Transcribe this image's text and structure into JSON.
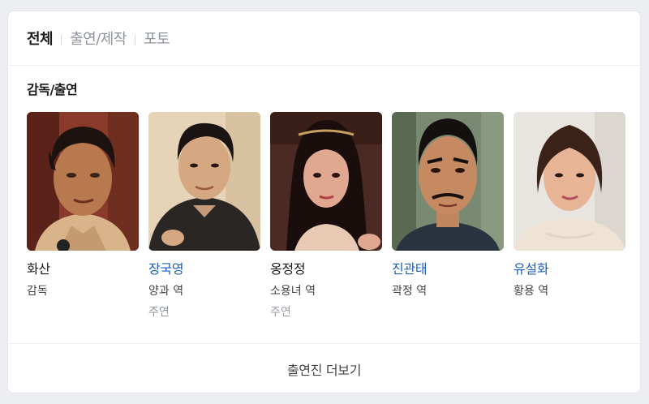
{
  "tabs": [
    {
      "label": "전체",
      "active": true
    },
    {
      "label": "출연/제작",
      "active": false
    },
    {
      "label": "포토",
      "active": false
    }
  ],
  "section": {
    "title": "감독/출연"
  },
  "cast": [
    {
      "name": "화산",
      "role": "감독",
      "linked": false
    },
    {
      "name": "장국영",
      "role": "양과 역",
      "sub": "주연",
      "linked": true
    },
    {
      "name": "옹정정",
      "role": "소용녀 역",
      "sub": "주연",
      "linked": false
    },
    {
      "name": "진관태",
      "role": "곽정 역",
      "linked": true
    },
    {
      "name": "유설화",
      "role": "황용 역",
      "linked": true
    }
  ],
  "more": {
    "label": "출연진 더보기"
  },
  "colors": {
    "link": "#1c5fbf",
    "background": "#eceef1",
    "card": "#ffffff"
  }
}
